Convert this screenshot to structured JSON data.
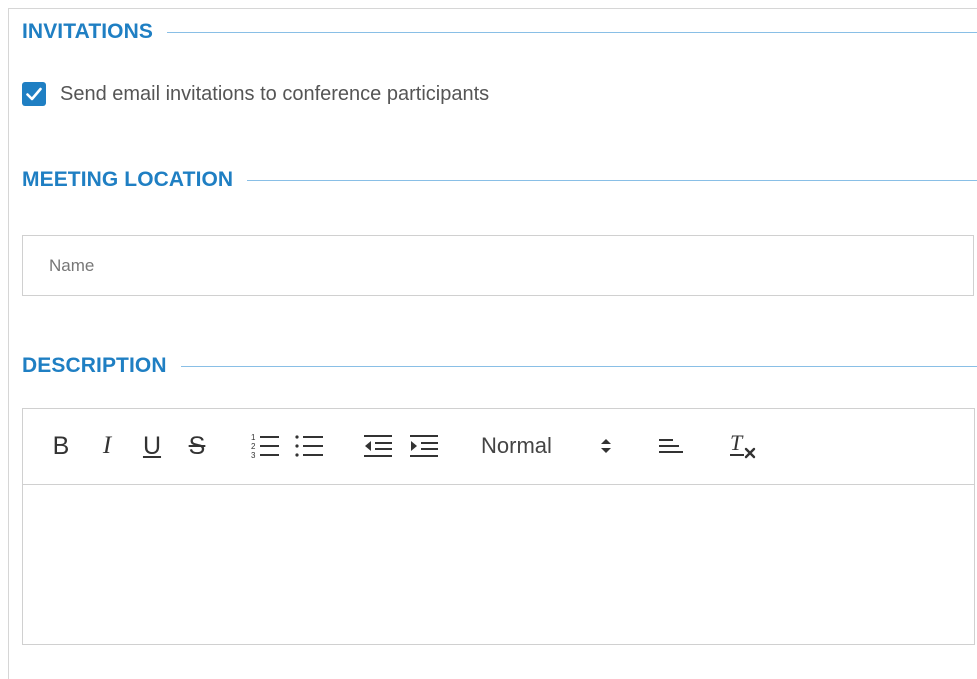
{
  "sections": {
    "invitations": {
      "title": "INVITATIONS",
      "checkbox_label": "Send email invitations to conference participants",
      "checked": true
    },
    "meeting_location": {
      "title": "MEETING LOCATION",
      "name_placeholder": "Name",
      "name_value": ""
    },
    "description": {
      "title": "DESCRIPTION",
      "toolbar": {
        "bold": "B",
        "italic": "I",
        "underline": "U",
        "strike": "S",
        "ordered_list_icon": "ordered-list-icon",
        "bullet_list_icon": "bullet-list-icon",
        "outdent_icon": "outdent-icon",
        "indent_icon": "indent-icon",
        "format_value": "Normal",
        "align_icon": "align-icon",
        "clear_format_icon": "clear-format-icon"
      },
      "content": ""
    }
  },
  "colors": {
    "accent": "#1f7fc3",
    "rule": "#89bfe6",
    "border": "#d0d0d0"
  }
}
